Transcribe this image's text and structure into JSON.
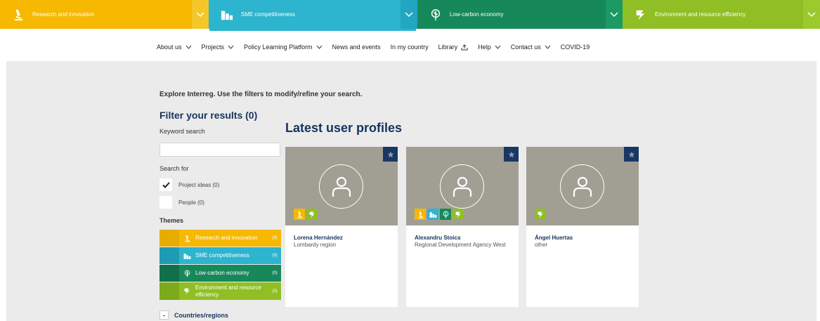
{
  "themes": [
    {
      "label": "Research and innovation",
      "color": "#f6b800",
      "icon": "microscope-icon"
    },
    {
      "label": "SME competitiveness",
      "color": "#2db4cf",
      "icon": "buildings-icon"
    },
    {
      "label": "Low-carbon economy",
      "color": "#17885a",
      "icon": "leaf-globe-icon"
    },
    {
      "label": "Environment and resource efficiency",
      "color": "#8fbf24",
      "icon": "recycle-icon"
    }
  ],
  "nav": [
    {
      "label": "About us",
      "icon": "chevron-down-icon"
    },
    {
      "label": "Projects",
      "icon": "chevron-down-icon"
    },
    {
      "label": "Policy Learning Platform",
      "icon": "chevron-down-icon"
    },
    {
      "label": "News and events"
    },
    {
      "label": "In my country"
    },
    {
      "label": "Library",
      "icon": "external-link-icon"
    },
    {
      "label": "Help",
      "icon": "chevron-down-icon"
    },
    {
      "label": "Contact us",
      "icon": "chevron-down-icon"
    },
    {
      "label": "COVID-19"
    }
  ],
  "intro": "Explore Interreg. Use the filters to modify/refine your search.",
  "filter": {
    "title": "Filter your results (0)",
    "keyword_label": "Keyword search",
    "keyword_value": "",
    "search_for_label": "Search for",
    "options": [
      {
        "label": "Project ideas (0)",
        "checked": true
      },
      {
        "label": "People (0)",
        "checked": false
      }
    ],
    "themes_label": "Themes",
    "theme_filters": [
      {
        "label": "Research and innovation",
        "count": "(0)",
        "lead": "#e6ac00",
        "color": "#f6b800"
      },
      {
        "label": "SME competitiveness",
        "count": "(0)",
        "lead": "#1e9bb4",
        "color": "#2db4cf"
      },
      {
        "label": "Low-carbon economy",
        "count": "(0)",
        "lead": "#10704a",
        "color": "#17885a"
      },
      {
        "label": "Environment and resource efficiency",
        "count": "(0)",
        "lead": "#7caa1a",
        "color": "#8fbf24"
      }
    ],
    "countries_label": "Countries/regions",
    "countries_toggle": "-"
  },
  "latest_title": "Latest user profiles",
  "profiles": [
    {
      "name": "Lorena Hernández",
      "org": "Lombardy region",
      "tags": [
        "microscope-icon",
        "recycle-icon"
      ]
    },
    {
      "name": "Alexandru Stoica",
      "org": "Regional Development Agency West",
      "tags": [
        "microscope-icon",
        "buildings-icon",
        "leaf-globe-icon",
        "recycle-icon"
      ]
    },
    {
      "name": "Ángel Huertas",
      "org": "other",
      "tags": [
        "recycle-icon"
      ]
    }
  ]
}
